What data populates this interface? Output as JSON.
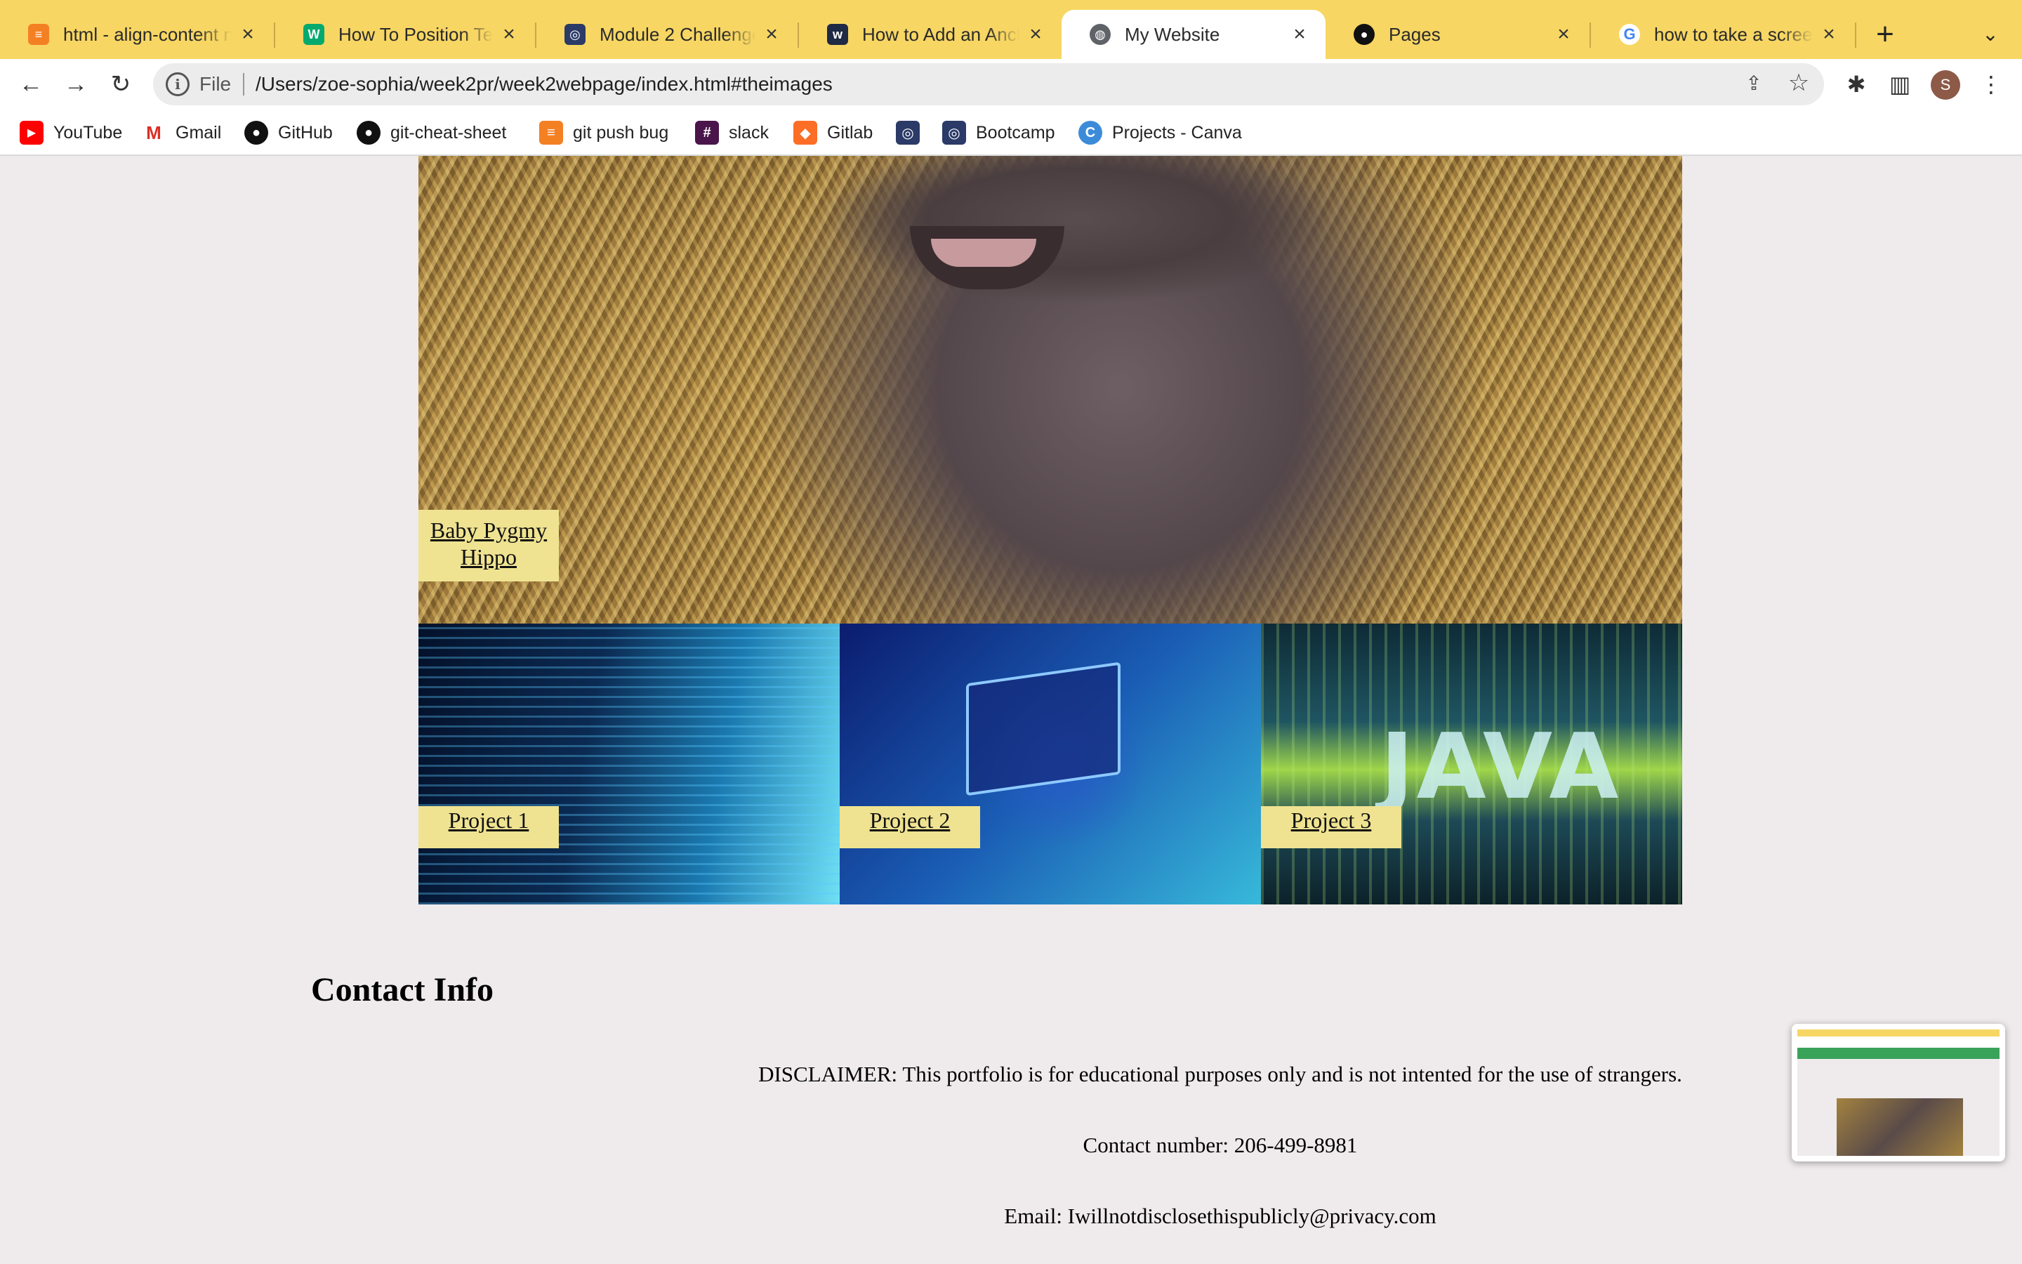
{
  "browser": {
    "tabs": [
      {
        "title": "html - align-content n",
        "favicon": "stackoverflow-icon",
        "active": false
      },
      {
        "title": "How To Position Text C",
        "favicon": "w3schools-icon",
        "active": false
      },
      {
        "title": "Module 2 Challenge",
        "favicon": "bootcamp-icon",
        "active": false
      },
      {
        "title": "How to Add an Ancho",
        "favicon": "w3-icon",
        "active": false
      },
      {
        "title": "My Website",
        "favicon": "globe-icon",
        "active": true
      },
      {
        "title": "Pages",
        "favicon": "github-icon",
        "active": false
      },
      {
        "title": "how to take a screens",
        "favicon": "google-icon",
        "active": false
      }
    ],
    "address": {
      "scheme_label": "File",
      "url": "/Users/zoe-sophia/week2pr/week2webpage/index.html#theimages"
    },
    "profile_initial": "S",
    "bookmarks": [
      {
        "label": "YouTube",
        "icon": "youtube-icon"
      },
      {
        "label": "Gmail",
        "icon": "gmail-icon"
      },
      {
        "label": "GitHub",
        "icon": "github-icon"
      },
      {
        "label": "git-cheat-sheet",
        "icon": "github-icon"
      },
      {
        "label": "git push bug",
        "icon": "stackoverflow-icon"
      },
      {
        "label": "slack",
        "icon": "slack-icon"
      },
      {
        "label": "Gitlab",
        "icon": "gitlab-icon"
      },
      {
        "label": "",
        "icon": "bootcamp-icon"
      },
      {
        "label": "Bootcamp",
        "icon": "bootcamp-icon"
      },
      {
        "label": "Projects - Canva",
        "icon": "canva-icon"
      }
    ],
    "colors": {
      "tabstrip": "#f7d663",
      "active_tab": "#ffffff",
      "page_bg": "#efebec",
      "label_bg": "#efe391"
    }
  },
  "page": {
    "hero_label": "Baby Pygmy Hippo",
    "projects": [
      {
        "label": "Project 1"
      },
      {
        "label": "Project 2"
      },
      {
        "label": "Project 3"
      }
    ],
    "contact": {
      "title": "Contact Info",
      "disclaimer": "DISCLAIMER: This portfolio is for educational purposes only and is not intented for the use of strangers.",
      "phone": "Contact number: 206-499-8981",
      "email": "Email: Iwillnotdisclosethispublicly@privacy.com"
    }
  }
}
